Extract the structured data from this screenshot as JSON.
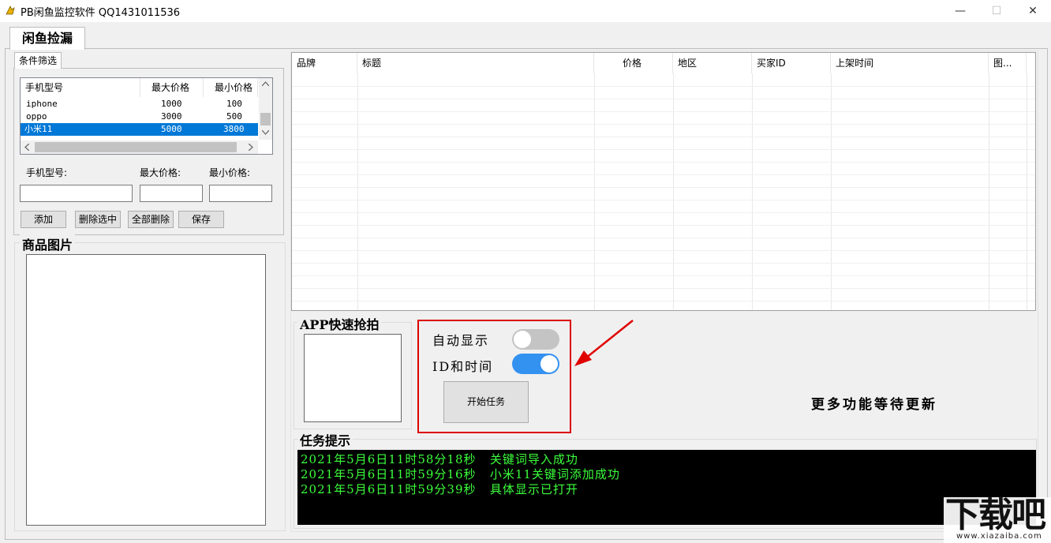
{
  "window": {
    "title": "PB闲鱼监控软件 QQ1431011536",
    "minimize_glyph": "—",
    "maximize_glyph": "☐",
    "close_glyph": "✕"
  },
  "main_tab": {
    "label": "闲鱼捡漏"
  },
  "filter": {
    "tab_label": "条件筛选",
    "list": {
      "headers": [
        "手机型号",
        "最大价格",
        "最小价格"
      ],
      "rows": [
        {
          "model": "iphone",
          "max": "1000",
          "min": "100",
          "selected": false
        },
        {
          "model": "oppo",
          "max": "3000",
          "min": "500",
          "selected": false
        },
        {
          "model": "小米11",
          "max": "5000",
          "min": "3800",
          "selected": true
        }
      ]
    },
    "model_label": "手机型号:",
    "max_label": "最大价格:",
    "min_label": "最小价格:",
    "model_value": "",
    "max_value": "",
    "min_value": "",
    "buttons": {
      "add": "添加",
      "delete_selected": "删除选中",
      "delete_all": "全部删除",
      "save": "保存"
    }
  },
  "product_image": {
    "title": "商品图片"
  },
  "grid": {
    "columns": [
      "品牌",
      "标题",
      "价格",
      "地区",
      "买家ID",
      "上架时间",
      "图..."
    ]
  },
  "app_quick": {
    "title": "APP快速抢拍"
  },
  "controls": {
    "auto_display": {
      "label": "自动显示",
      "on": false
    },
    "id_time": {
      "label": "ID和时间",
      "on": true
    },
    "start_button": "开始任务"
  },
  "more_features": "更多功能等待更新",
  "task_log": {
    "title": "任务提示",
    "lines": [
      "2021年5月6日11时58分18秒   关键词导入成功",
      "2021年5月6日11时59分16秒   小米11关键词添加成功",
      "2021年5月6日11时59分39秒   具体显示已打开"
    ]
  },
  "watermark": {
    "text": "下载吧",
    "url": "www.xiazaiba.com"
  },
  "colors": {
    "accent": "#3391f0",
    "toggle_off": "#c4c4c4",
    "highlight_frame": "#dd0000",
    "log_text": "#3cff3c",
    "selection": "#0078d7"
  }
}
